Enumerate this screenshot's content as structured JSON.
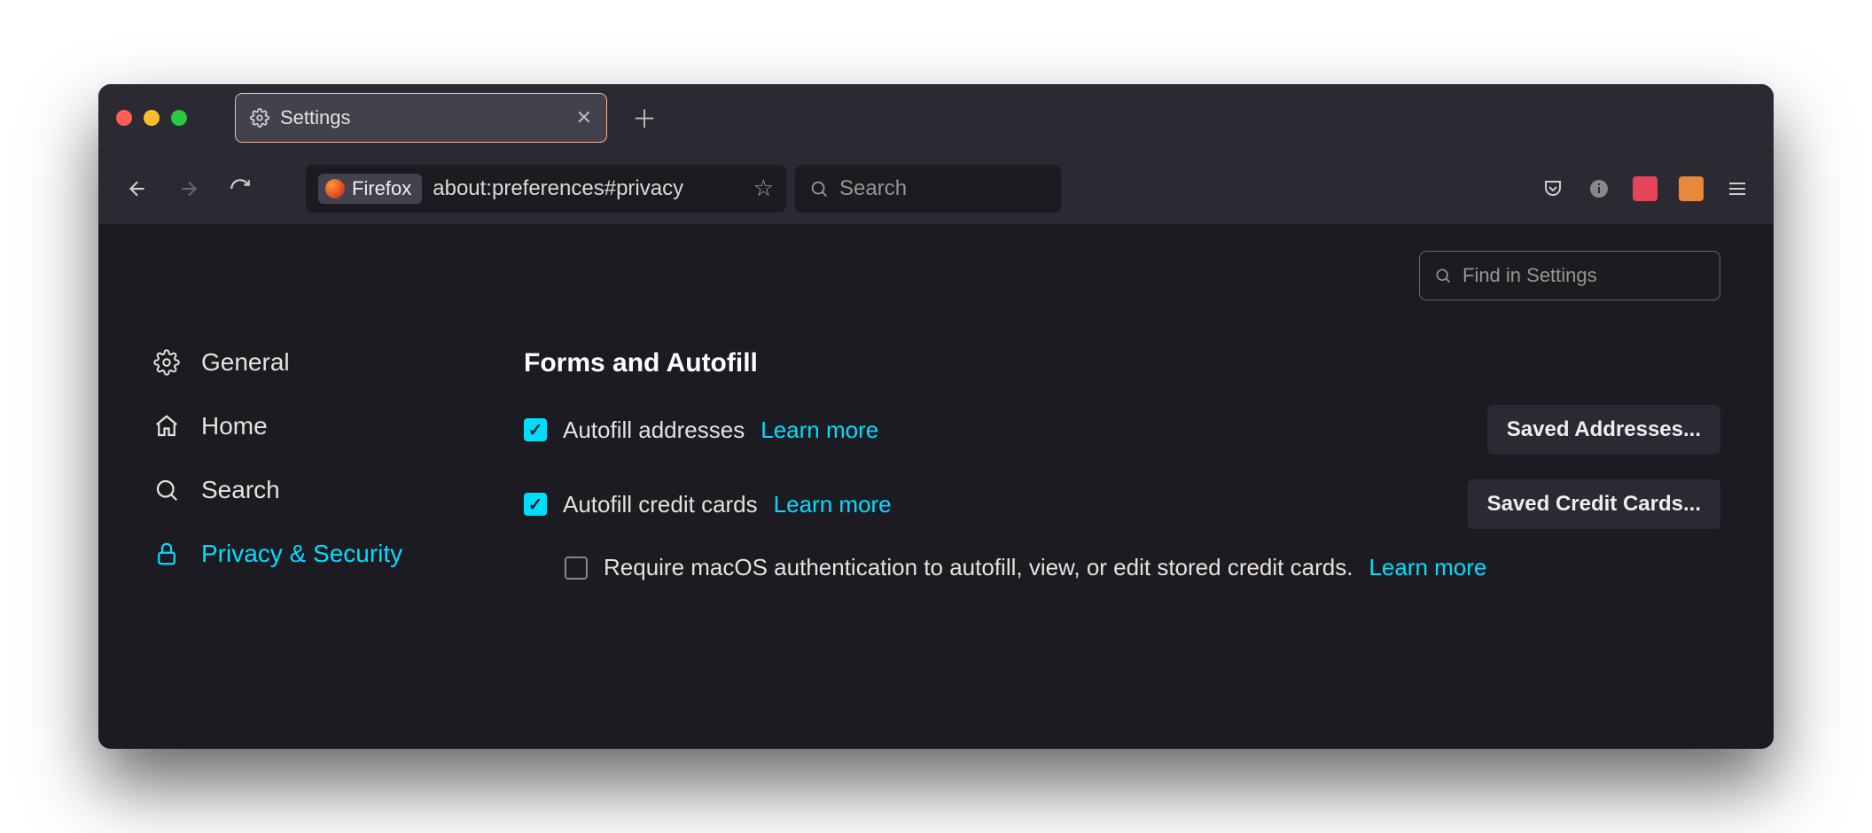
{
  "tab": {
    "title": "Settings"
  },
  "urlbar": {
    "badge": "Firefox",
    "url": "about:preferences#privacy"
  },
  "searchbar": {
    "placeholder": "Search"
  },
  "find": {
    "placeholder": "Find in Settings"
  },
  "sidebar": {
    "general": "General",
    "home": "Home",
    "search": "Search",
    "privacy": "Privacy & Security"
  },
  "section": {
    "title": "Forms and Autofill"
  },
  "row1": {
    "label": "Autofill addresses",
    "learn": "Learn more",
    "button": "Saved Addresses..."
  },
  "row2": {
    "label": "Autofill credit cards",
    "learn": "Learn more",
    "button": "Saved Credit Cards..."
  },
  "row3": {
    "label": "Require macOS authentication to autofill, view, or edit stored credit cards.",
    "learn": "Learn more"
  }
}
